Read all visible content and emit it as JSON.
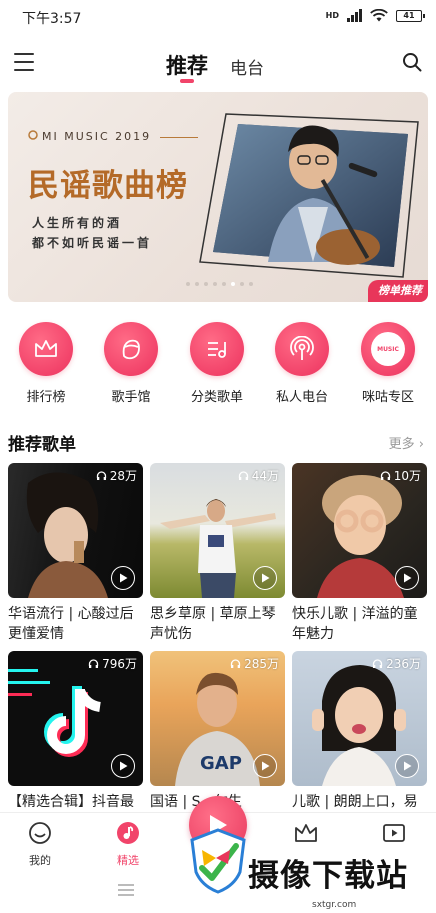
{
  "status_bar": {
    "time": "下午3:57",
    "network": "HD",
    "battery": "41"
  },
  "top_nav": {
    "tabs": [
      {
        "label": "推荐",
        "active": true
      },
      {
        "label": "电台",
        "active": false
      }
    ]
  },
  "banner": {
    "brand": "MI MUSIC 2019",
    "title": "民谣歌曲榜",
    "subtitle_lines": [
      "人生所有的酒",
      "都不如听民谣一首"
    ],
    "tag": "榜单推荐",
    "dot_count": 8,
    "active_dot": 5
  },
  "quick_entries": [
    {
      "label": "排行榜",
      "icon": "crown-icon"
    },
    {
      "label": "歌手馆",
      "icon": "singer-face-icon"
    },
    {
      "label": "分类歌单",
      "icon": "playlist-category-icon"
    },
    {
      "label": "私人电台",
      "icon": "radio-broadcast-icon"
    },
    {
      "label": "咪咕专区",
      "icon": "migu-music-icon",
      "icon_text": "MUSIC"
    }
  ],
  "section": {
    "title": "推荐歌单",
    "more": "更多"
  },
  "playlists": [
    {
      "count": "28万",
      "title": "华语流行 | 心酸过后更懂爱情"
    },
    {
      "count": "44万",
      "title": "思乡草原 | 草原上琴声忧伤"
    },
    {
      "count": "10万",
      "title": "快乐儿歌 | 洋溢的童年魅力"
    },
    {
      "count": "796万",
      "title": "【精选合辑】抖音最"
    },
    {
      "count": "285万",
      "title": "国语 | S...尔生"
    },
    {
      "count": "236万",
      "title": "儿歌 | 朗朗上口，易"
    }
  ],
  "bottom_nav": [
    {
      "label": "我的",
      "icon": "smile-face-icon",
      "active": false
    },
    {
      "label": "精选",
      "icon": "music-note-circle-icon",
      "active": true
    },
    {
      "label": "",
      "icon": "crown-outline-icon",
      "active": false
    },
    {
      "label": "",
      "icon": "video-play-icon",
      "active": false
    }
  ],
  "watermark": {
    "text": "摄像下载站",
    "url": "sxtgr.com"
  },
  "colors": {
    "accent": "#f1446a",
    "banner_title": "#b46a28",
    "tag_bg": "#e8365a"
  }
}
